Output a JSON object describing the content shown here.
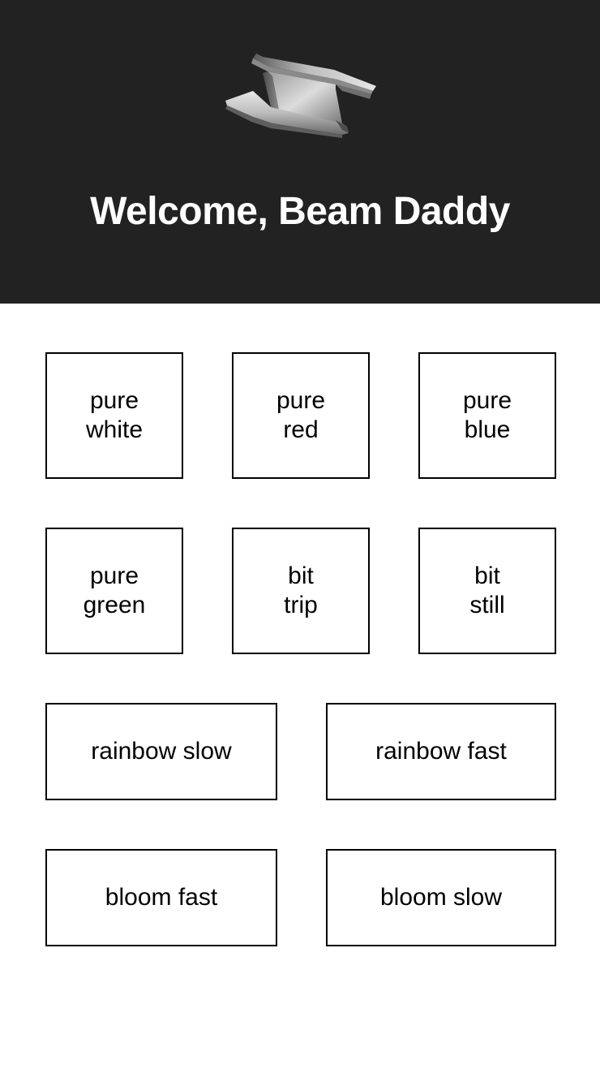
{
  "header": {
    "title": "Welcome, Beam Daddy",
    "logo_icon": "steel-i-beam-icon",
    "background_color": "#222222",
    "title_color": "#ffffff"
  },
  "buttons": [
    {
      "id": "pure-white",
      "label": "pure white"
    },
    {
      "id": "pure-red",
      "label": "pure red"
    },
    {
      "id": "pure-blue",
      "label": "pure blue"
    },
    {
      "id": "pure-green",
      "label": "pure green"
    },
    {
      "id": "bit-trip",
      "label": "bit trip"
    },
    {
      "id": "bit-still",
      "label": "bit still"
    },
    {
      "id": "rainbow-slow",
      "label": "rainbow slow"
    },
    {
      "id": "rainbow-fast",
      "label": "rainbow fast"
    },
    {
      "id": "bloom-fast",
      "label": "bloom fast"
    },
    {
      "id": "bloom-slow",
      "label": "bloom slow"
    }
  ],
  "colors": {
    "button_border": "#000000",
    "button_background": "#ffffff",
    "button_text": "#000000"
  }
}
